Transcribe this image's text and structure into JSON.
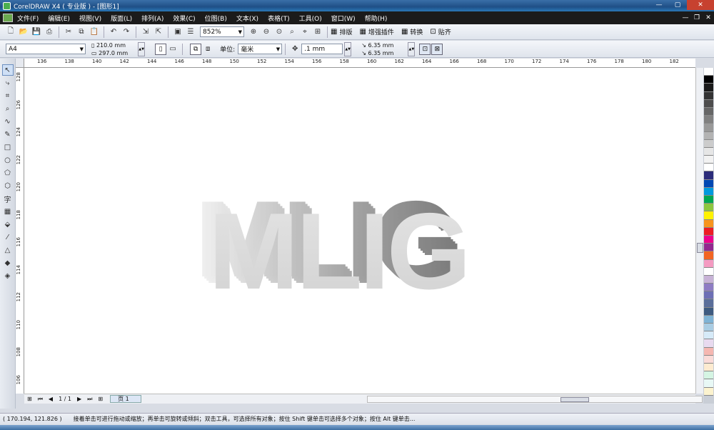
{
  "window": {
    "title": "CorelDRAW X4 ( 专业版 ) - [图形1]",
    "min": "—",
    "max": "▢",
    "close": "✕"
  },
  "menu": [
    "文件(F)",
    "编辑(E)",
    "视图(V)",
    "版面(L)",
    "排列(A)",
    "效果(C)",
    "位图(B)",
    "文本(X)",
    "表格(T)",
    "工具(O)",
    "窗口(W)",
    "帮助(H)"
  ],
  "toolbar": {
    "zoom_value": "852%",
    "plugins": [
      "排版",
      "增强插件",
      "转换",
      "贴齐"
    ]
  },
  "propertybar": {
    "paper_size": "A4",
    "width": "210.0 mm",
    "height": "297.0 mm",
    "unit_label": "单位:",
    "unit_value": "毫米",
    "nudge": ".1 mm",
    "dup_x": "6.35 mm",
    "dup_y": "6.35 mm"
  },
  "ruler": {
    "top_labels": [
      "136",
      "138",
      "140",
      "142",
      "144",
      "146",
      "148",
      "150",
      "152",
      "154",
      "156",
      "158",
      "160",
      "162",
      "164",
      "166",
      "168",
      "170",
      "172",
      "174",
      "176",
      "178",
      "180",
      "182"
    ],
    "left_labels": [
      "128",
      "126",
      "124",
      "122",
      "120",
      "118",
      "116",
      "114",
      "112",
      "110",
      "108",
      "106"
    ]
  },
  "canvas": {
    "art_text": "MLIG"
  },
  "pagebar": {
    "page_count": "1 / 1",
    "page_tab": "页 1"
  },
  "status": {
    "coords": "( 170.194, 121.826 )",
    "hint": "接着单击可进行拖动或缩放；再单击可旋转或倾斜；双击工具，可选择所有对象；按住 Shift 键单击可选择多个对象；按住 Alt 键单击..."
  },
  "palette_colors": [
    "#ffffff",
    "#000000",
    "#1a1a1a",
    "#333333",
    "#4d4d4d",
    "#666666",
    "#808080",
    "#999999",
    "#b3b3b3",
    "#cccccc",
    "#e6e6e6",
    "#f2f2f2",
    "#ffffff",
    "#2b2b7a",
    "#0047b3",
    "#0099dd",
    "#00a651",
    "#8dc63f",
    "#fff200",
    "#f7941d",
    "#ed1c24",
    "#ec008c",
    "#92278f",
    "#f26522",
    "#f49ac1",
    "#ffffff",
    "#c7b2d6",
    "#8e7cc3",
    "#6d6fb5",
    "#5a6e9a",
    "#3d5a80",
    "#7fb3d5",
    "#a9cce3",
    "#d6eaf8",
    "#e8daef",
    "#f5b7b1",
    "#fadbd8",
    "#fdebd0",
    "#d5f5e3",
    "#e8f8f5",
    "#fcf3cf"
  ]
}
